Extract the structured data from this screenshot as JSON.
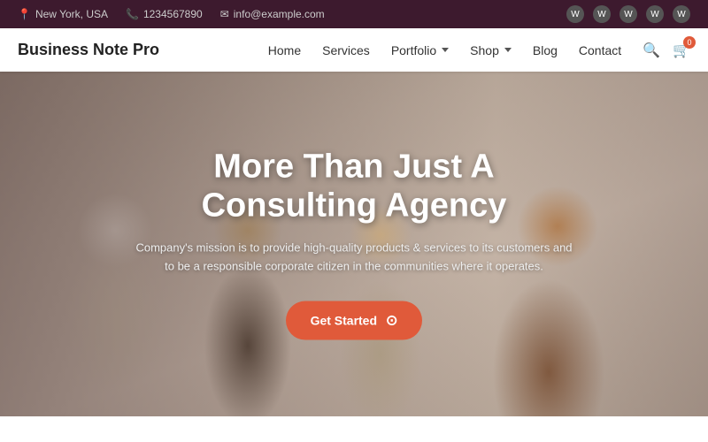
{
  "topbar": {
    "location": "New York, USA",
    "phone": "1234567890",
    "email": "info@example.com"
  },
  "header": {
    "logo": "Business Note Pro",
    "nav": {
      "home": "Home",
      "services": "Services",
      "portfolio": "Portfolio",
      "shop": "Shop",
      "blog": "Blog",
      "contact": "Contact"
    },
    "cart_count": "0"
  },
  "hero": {
    "title": "More Than Just A Consulting Agency",
    "subtitle": "Company's mission is to provide high-quality products & services to its customers and to be a responsible corporate citizen in the communities where it operates.",
    "cta_label": "Get Started"
  }
}
